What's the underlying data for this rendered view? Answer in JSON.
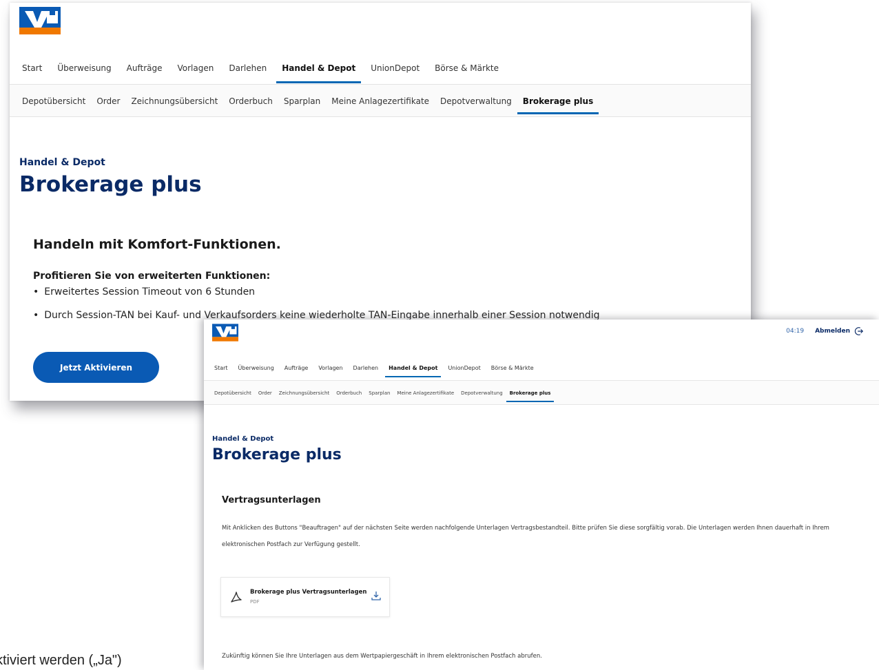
{
  "background": {
    "partial_text": "ktiviert werden („Ja\")"
  },
  "shot1": {
    "nav": [
      "Start",
      "Überweisung",
      "Aufträge",
      "Vorlagen",
      "Darlehen",
      "Handel & Depot",
      "UnionDepot",
      "Börse & Märkte"
    ],
    "nav_active": "Handel & Depot",
    "subnav": [
      "Depotübersicht",
      "Order",
      "Zeichnungsübersicht",
      "Orderbuch",
      "Sparplan",
      "Meine Anlagezertifikate",
      "Depotverwaltung",
      "Brokerage plus"
    ],
    "subnav_active": "Brokerage plus",
    "eyebrow": "Handel & Depot",
    "title": "Brokerage plus",
    "headline": "Handeln mit Komfort-Funktionen.",
    "subheadline": "Profitieren Sie von erweiterten Funktionen:",
    "bullets": [
      "Erweitertes Session Timeout von 6 Stunden",
      "Durch Session-TAN bei Kauf- und Verkaufsorders keine wiederholte TAN-Eingabe innerhalb einer Session notwendig"
    ],
    "activate_button": "Jetzt Aktivieren"
  },
  "shot2": {
    "time": "04:19",
    "logout_label": "Abmelden",
    "nav": [
      "Start",
      "Überweisung",
      "Aufträge",
      "Vorlagen",
      "Darlehen",
      "Handel & Depot",
      "UnionDepot",
      "Börse & Märkte"
    ],
    "nav_active": "Handel & Depot",
    "subnav": [
      "Depotübersicht",
      "Order",
      "Zeichnungsübersicht",
      "Orderbuch",
      "Sparplan",
      "Meine Anlagezertifikate",
      "Depotverwaltung",
      "Brokerage plus"
    ],
    "subnav_active": "Brokerage plus",
    "eyebrow": "Handel & Depot",
    "title": "Brokerage plus",
    "section_title": "Vertragsunterlagen",
    "paragraph": "Mit Anklicken des Buttons \"Beauftragen\" auf der nächsten Seite werden nachfolgende Unterlagen Vertragsbestandteil. Bitte prüfen Sie diese sorgfältig vorab. Die Unterlagen werden Ihnen dauerhaft in Ihrem elektronischen Postfach zur Verfügung gestellt.",
    "document": {
      "title": "Brokerage plus Vertragsunterlagen",
      "type": "PDF"
    },
    "note": "Zukünftig können Sie Ihre Unterlagen aus dem Wertpapiergeschäft in Ihrem elektronischen Postfach abrufen."
  },
  "colors": {
    "brand_blue": "#0a2a66",
    "accent_blue": "#0066b3",
    "brand_orange": "#f07800"
  }
}
